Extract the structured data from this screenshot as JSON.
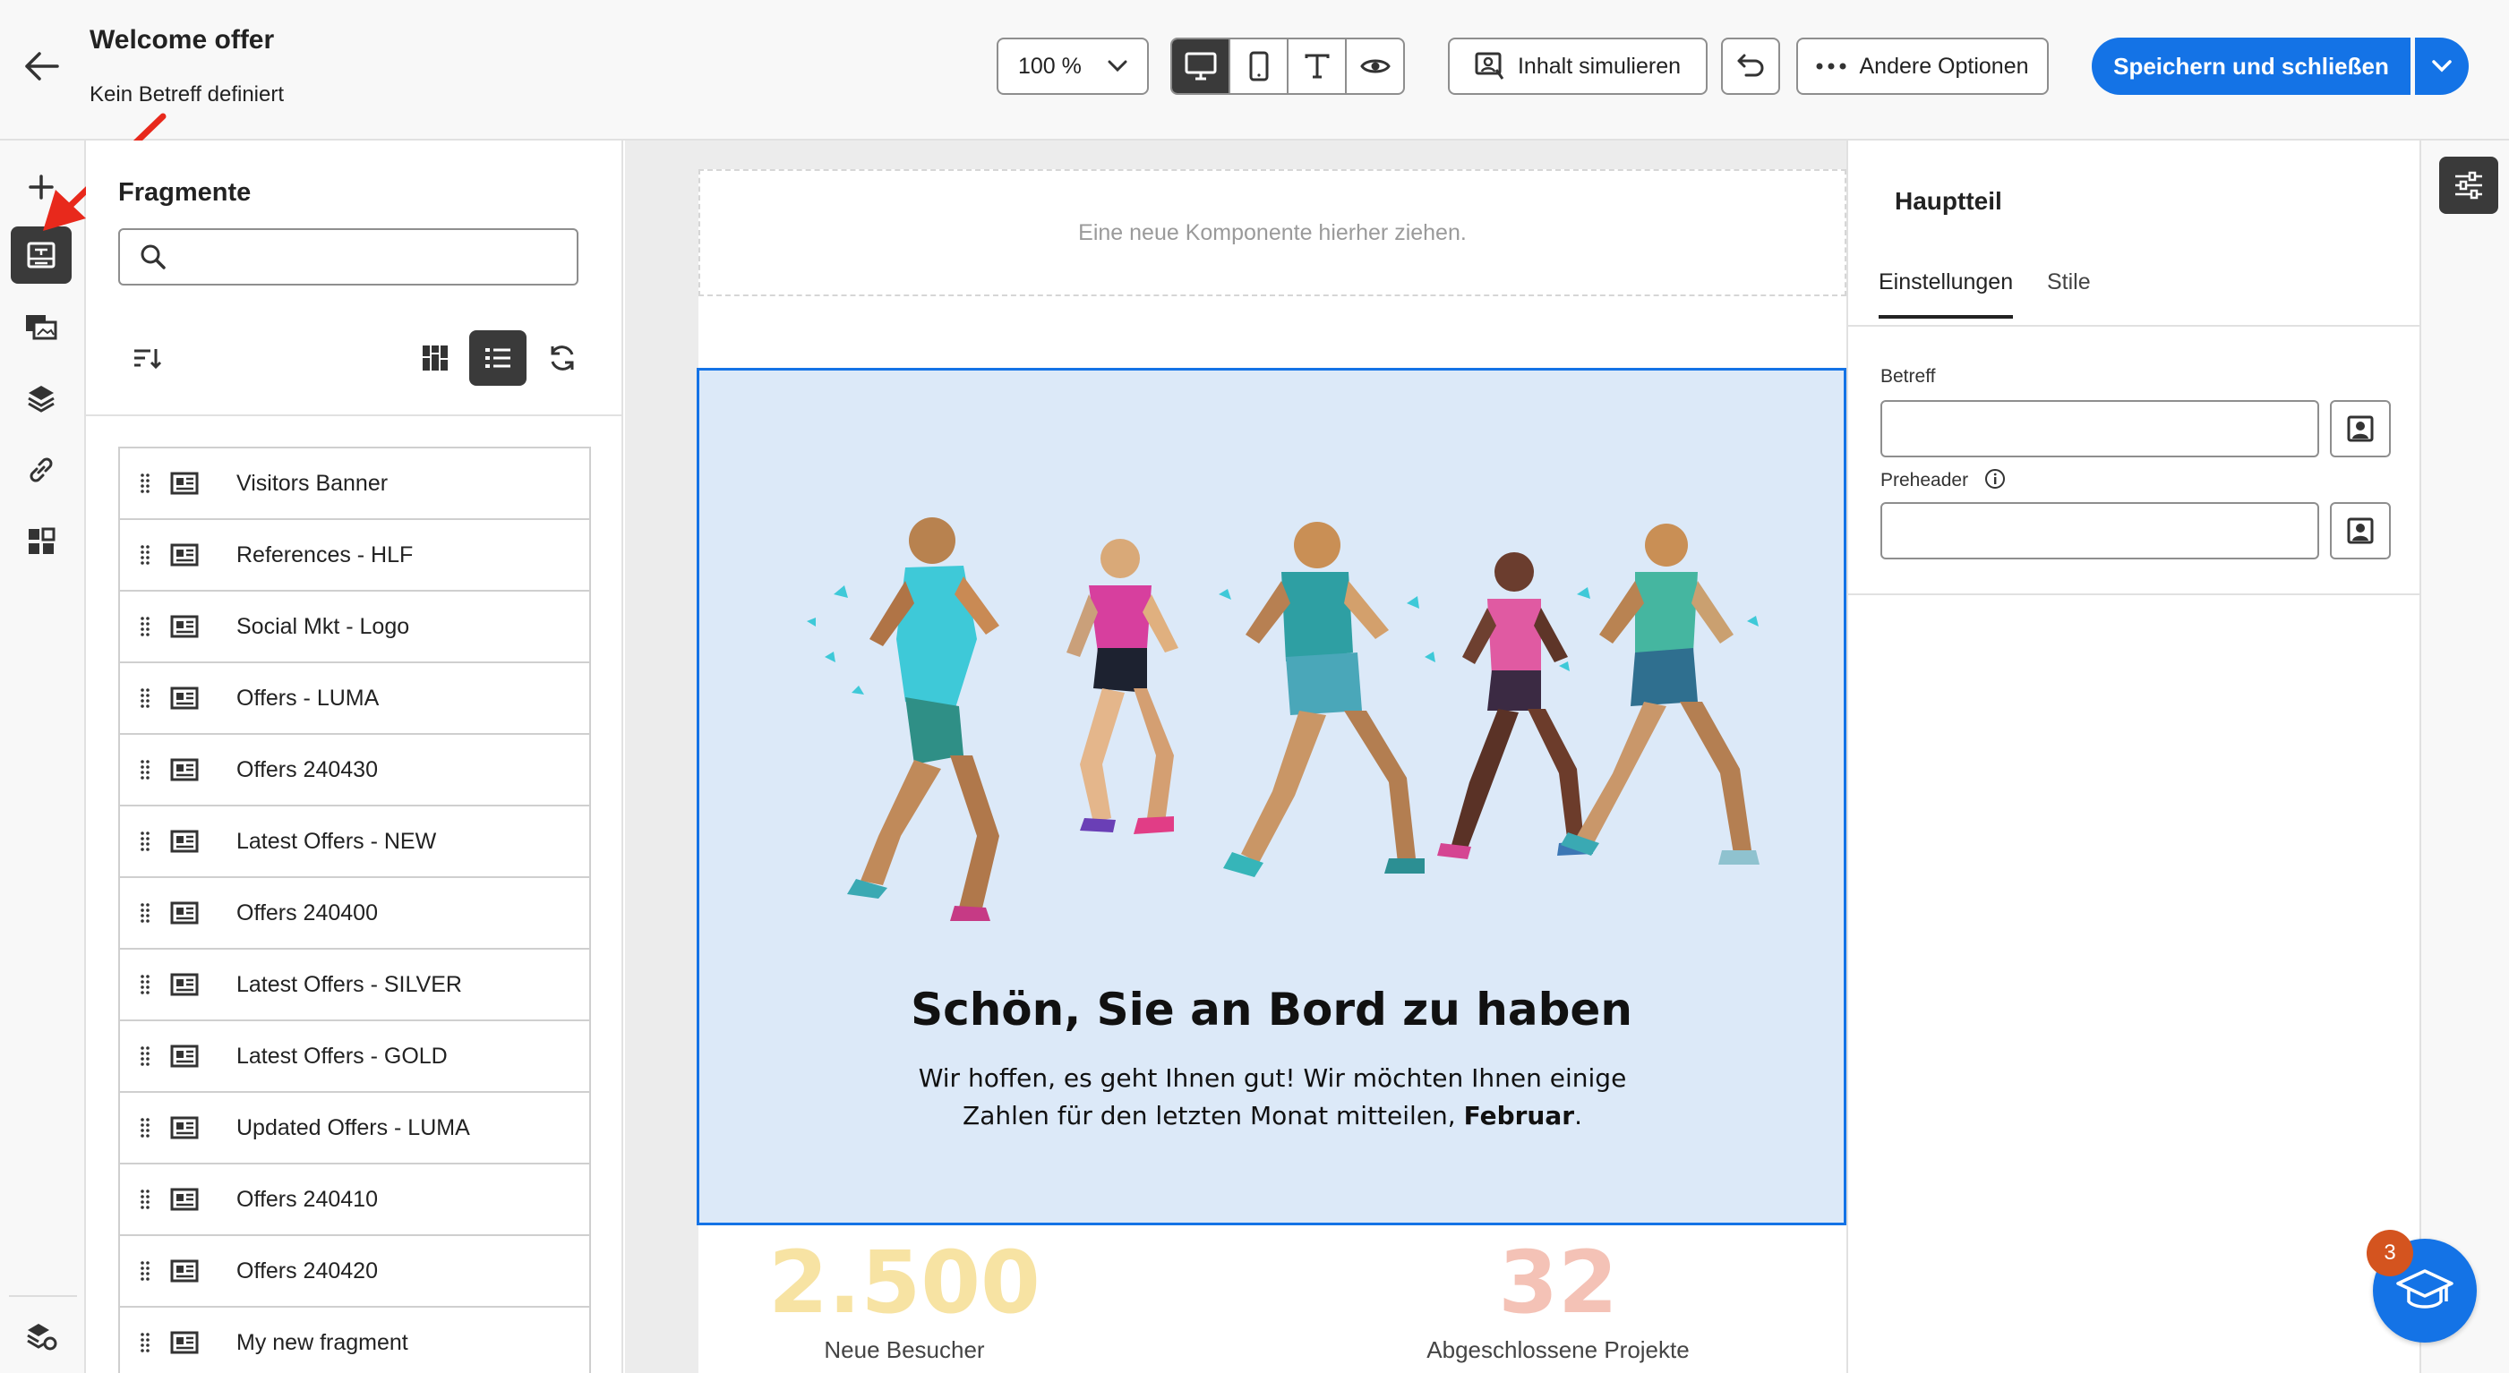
{
  "header": {
    "title": "Welcome offer",
    "subtitle": "Kein Betreff definiert",
    "zoom": "100 %",
    "simulate_label": "Inhalt simulieren",
    "more_label": "Andere Optionen",
    "save_label": "Speichern und schließen"
  },
  "fragments": {
    "title": "Fragmente",
    "search_value": "",
    "items": [
      "Visitors Banner",
      "References - HLF",
      "Social Mkt - Logo",
      "Offers - LUMA",
      "Offers 240430",
      "Latest Offers - NEW",
      "Offers 240400",
      "Latest Offers - SILVER",
      "Latest Offers - GOLD",
      "Updated Offers - LUMA",
      "Offers 240410",
      "Offers 240420",
      "My new fragment"
    ]
  },
  "canvas": {
    "dropzone_text": "Eine neue Komponente hierher ziehen.",
    "hero_title": "Schön, Sie an Bord zu haben",
    "hero_text_1": "Wir hoffen, es geht Ihnen gut! Wir möchten Ihnen einige Zahlen für den letzten Monat mitteilen, ",
    "hero_text_bold": "Februar",
    "hero_text_end": ".",
    "stats": [
      {
        "value": "2.500",
        "label": "Neue Besucher",
        "color": "#f7e3a3"
      },
      {
        "value": "32",
        "label": "Abgeschlossene Projekte",
        "color": "#f4c2b6"
      }
    ]
  },
  "properties": {
    "title": "Hauptteil",
    "tabs": [
      "Einstellungen",
      "Stile"
    ],
    "subject_label": "Betreff",
    "subject_value": "",
    "preheader_label": "Preheader",
    "preheader_value": ""
  },
  "help": {
    "badge": "3"
  },
  "colors": {
    "accent": "#1473e6",
    "selected": "#3a3a3a",
    "hero_bg": "#dce9f8",
    "annotation": "#e8291c"
  }
}
